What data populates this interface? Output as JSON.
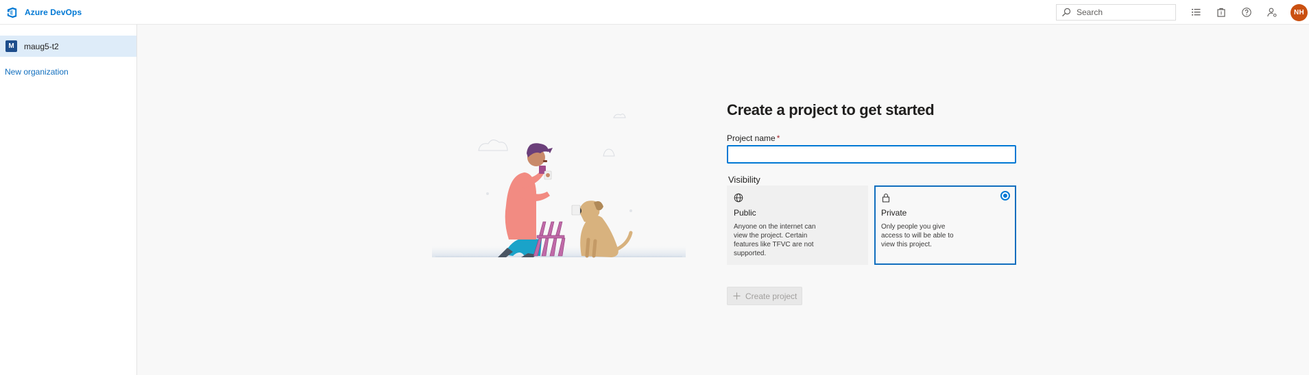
{
  "app": {
    "brand": "Azure DevOps"
  },
  "header": {
    "search_placeholder": "Search",
    "icons": [
      "work-items-icon",
      "marketplace-icon",
      "help-icon",
      "user-settings-icon"
    ],
    "avatar_initials": "NH",
    "avatar_color": "#ca5010"
  },
  "sidebar": {
    "organizations": [
      {
        "initial": "M",
        "name": "maug5-t2",
        "selected": true
      }
    ],
    "new_org_label": "New organization"
  },
  "main": {
    "title": "Create a project to get started",
    "project_name_label": "Project name",
    "required_marker": "*",
    "project_name_value": "",
    "visibility_label": "Visibility",
    "visibility_options": [
      {
        "icon": "globe-icon",
        "title": "Public",
        "description": "Anyone on the internet can view the project. Certain features like TFVC are not supported.",
        "selected": false
      },
      {
        "icon": "lock-icon",
        "title": "Private",
        "description": "Only people you give access to will be able to view this project.",
        "selected": true
      }
    ],
    "create_button_label": "Create project",
    "create_button_enabled": false
  },
  "colors": {
    "accent": "#0078d4",
    "link": "#106ebe",
    "selected_org_bg": "#deecf9"
  }
}
